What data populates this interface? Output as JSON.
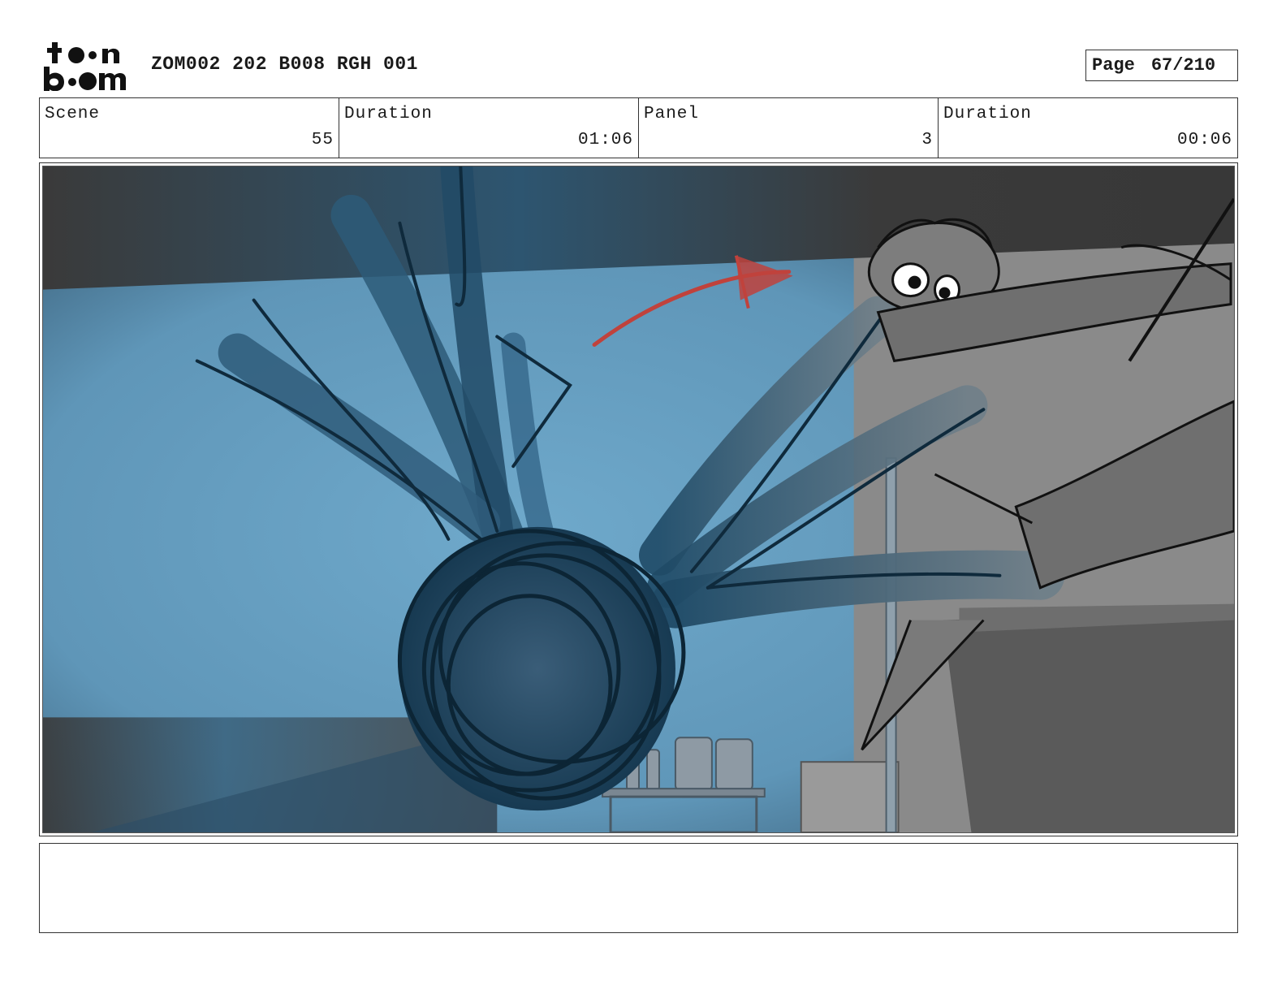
{
  "header": {
    "logo_text_top": "toon",
    "logo_text_bottom": "boom",
    "document_title": "ZOM002 202 B008 RGH 001",
    "page_label": "Page",
    "page_number": "67/210"
  },
  "info": {
    "scene_label": "Scene",
    "scene_value": "55",
    "scene_duration_label": "Duration",
    "scene_duration_value": "01:06",
    "panel_label": "Panel",
    "panel_value": "3",
    "panel_duration_label": "Duration",
    "panel_duration_value": "00:06"
  },
  "notes": {
    "text": ""
  },
  "colors": {
    "sky_blue": "#6aa3c5",
    "dark_blue": "#1f4a66",
    "gray": "#8a8a8a",
    "dark_gray": "#3d3d3d",
    "arrow_red": "#c0423c"
  }
}
